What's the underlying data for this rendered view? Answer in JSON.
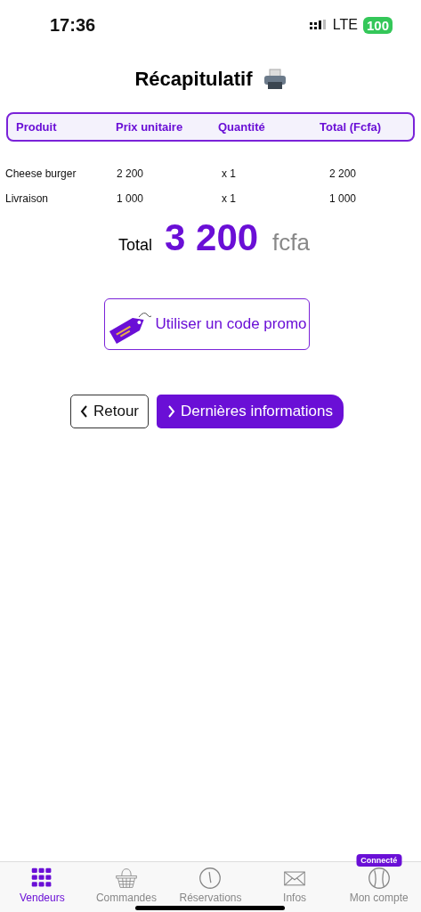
{
  "status_bar": {
    "time": "17:36",
    "network": "LTE",
    "battery": "100"
  },
  "title": "Récapitulatif",
  "table": {
    "columns": [
      "Produit",
      "Prix unitaire",
      "Quantité",
      "Total (Fcfa)"
    ],
    "rows": [
      [
        "Cheese burger",
        "2 200",
        "x 1",
        "2 200"
      ],
      [
        "Livraison",
        "1 000",
        "x 1",
        "1 000"
      ]
    ]
  },
  "total": {
    "label": "Total",
    "amount": "3 200",
    "currency": "fcfa"
  },
  "promo_button": "Utiliser un code promo",
  "buttons": [
    {
      "kind": "back",
      "label": "Retour"
    },
    {
      "kind": "next",
      "label": "Dernières informations"
    }
  ],
  "tab_bar": [
    {
      "label": "Vendeurs",
      "kind": "grid",
      "selected": true
    },
    {
      "label": "Commandes",
      "kind": "basket",
      "selected": false
    },
    {
      "label": "Réservations",
      "kind": "clock",
      "selected": false
    },
    {
      "label": "Infos",
      "kind": "mail",
      "selected": false
    },
    {
      "label": "Mon compte",
      "kind": "user",
      "selected": false,
      "badge": "Connecté"
    }
  ]
}
